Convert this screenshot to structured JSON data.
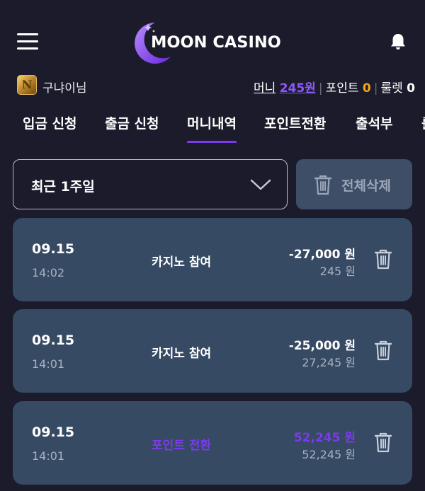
{
  "header": {
    "logo_text_moon": "MOON",
    "logo_text_casino": "CASINO"
  },
  "user": {
    "name": "구냐이님",
    "money_label": "머니",
    "money_value": "245원",
    "point_label": "포인트",
    "point_value": "0",
    "roulette_label": "룰렛",
    "roulette_value": "0"
  },
  "tabs": [
    {
      "label": "입금 신청"
    },
    {
      "label": "출금 신청"
    },
    {
      "label": "머니내역",
      "active": true
    },
    {
      "label": "포인트전환"
    },
    {
      "label": "출석부"
    },
    {
      "label": "룰"
    }
  ],
  "filter": {
    "period_selected": "최근 1주일",
    "delete_all_label": "전체삭제"
  },
  "history": [
    {
      "date": "09.15",
      "time": "14:02",
      "type": "카지노 참여",
      "amount": "-27,000 원",
      "balance": "245 원"
    },
    {
      "date": "09.15",
      "time": "14:01",
      "type": "카지노 참여",
      "amount": "-25,000 원",
      "balance": "27,245 원"
    },
    {
      "date": "09.15",
      "time": "14:01",
      "type": "포인트 전환",
      "amount": "52,245 원",
      "balance": "52,245 원"
    }
  ],
  "colors": {
    "background": "#1b1b2b",
    "card": "#364a63",
    "accent_purple": "#7c3aed",
    "point_orange": "#f5a623"
  }
}
